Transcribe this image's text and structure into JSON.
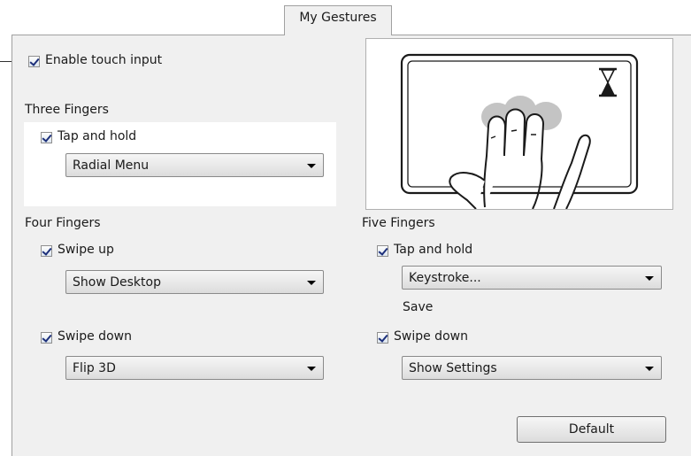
{
  "tab": {
    "label": "My Gestures"
  },
  "enable_touch": {
    "label": "Enable touch input",
    "checked": true
  },
  "three_fingers": {
    "heading": "Three Fingers",
    "tap_and_hold": {
      "label": "Tap and hold",
      "checked": true,
      "action": "Radial Menu"
    }
  },
  "four_fingers": {
    "heading": "Four Fingers",
    "swipe_up": {
      "label": "Swipe up",
      "checked": true,
      "action": "Show Desktop"
    },
    "swipe_down": {
      "label": "Swipe down",
      "checked": true,
      "action": "Flip 3D"
    }
  },
  "five_fingers": {
    "heading": "Five Fingers",
    "tap_and_hold": {
      "label": "Tap and hold",
      "checked": true,
      "action": "Keystroke...",
      "note": "Save"
    },
    "swipe_down": {
      "label": "Swipe down",
      "checked": true,
      "action": "Show Settings"
    }
  },
  "default_button": {
    "label": "Default"
  },
  "illustration": {
    "icons": [
      "hourglass-icon",
      "hand-icon"
    ]
  }
}
